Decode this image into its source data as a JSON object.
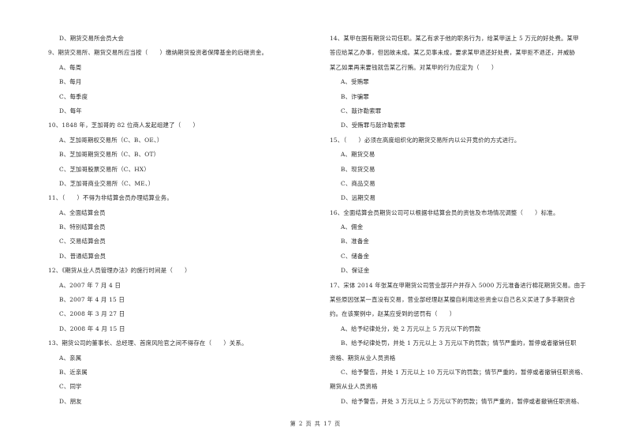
{
  "left_column": {
    "lines": [
      {
        "type": "option",
        "text": "D、期货交易所会员大会"
      },
      {
        "type": "question",
        "text": "9、期货交易所、期货交易所应当按（　　）缴纳期货投资者保障基金的后继资金。"
      },
      {
        "type": "option",
        "text": "A、每周"
      },
      {
        "type": "option",
        "text": "B、每月"
      },
      {
        "type": "option",
        "text": "C、每季度"
      },
      {
        "type": "option",
        "text": "D、每年"
      },
      {
        "type": "question",
        "text": "10、1848 年，芝加哥的 82 位商人发起组建了（　　）"
      },
      {
        "type": "option",
        "text": "A、芝加哥期权交易所（C、B、OE、）"
      },
      {
        "type": "option",
        "text": "B、芝加哥期货交易所（C、B、OT）"
      },
      {
        "type": "option",
        "text": "C、芝加哥股票交易所（C、HX）"
      },
      {
        "type": "option",
        "text": "D、芝加哥商业交易所（C、ME、）"
      },
      {
        "type": "question",
        "text": "11、（　　）不得为非结算会员办理结算业务。"
      },
      {
        "type": "option",
        "text": "A、全面结算会员"
      },
      {
        "type": "option",
        "text": "B、特别结算会员"
      },
      {
        "type": "option",
        "text": "C、交易结算会员"
      },
      {
        "type": "option",
        "text": "D、普通结算会员"
      },
      {
        "type": "question",
        "text": "12、《期货从业人员管理办法》的施行时间是（　　）"
      },
      {
        "type": "option",
        "text": "A、2007 年 7 月 4 日"
      },
      {
        "type": "option",
        "text": "B、2007 年 4 月 15 日"
      },
      {
        "type": "option",
        "text": "C、2008 年 3 月 27 日"
      },
      {
        "type": "option",
        "text": "D、2008 年 4 月 15 日"
      },
      {
        "type": "question",
        "text": "13、期货公司的董事长、总经理、首席风险官之间不得存在（　　）关系。"
      },
      {
        "type": "option",
        "text": "A、亲属"
      },
      {
        "type": "option",
        "text": "B、近亲属"
      },
      {
        "type": "option",
        "text": "C、同学"
      },
      {
        "type": "option",
        "text": "D、朋友"
      }
    ]
  },
  "right_column": {
    "lines": [
      {
        "type": "question",
        "text": "14、某甲在国有期货公司任职。某乙有求于他的职务行为，给某甲送上 5 万元的好处费。某甲"
      },
      {
        "type": "question",
        "text": "答应给某乙办事，但因故未成。某乙见事未成，要求某甲退还好处费，某甲拒不退还，并威胁"
      },
      {
        "type": "question",
        "text": "某乙如果再来要钱就告某乙行贿。对某甲的行为应定为（　　）"
      },
      {
        "type": "option",
        "text": "A、受贿罪"
      },
      {
        "type": "option",
        "text": "B、诈骗罪"
      },
      {
        "type": "option",
        "text": "C、敲诈勒索罪"
      },
      {
        "type": "option",
        "text": "D、受贿罪与敲诈勒索罪"
      },
      {
        "type": "question",
        "text": "15、（　　）必须在高度组织化的期货交易所内以公开竞价的方式进行。"
      },
      {
        "type": "option",
        "text": "A、期货交易"
      },
      {
        "type": "option",
        "text": "B、现货交易"
      },
      {
        "type": "option",
        "text": "C、商品交易"
      },
      {
        "type": "option",
        "text": "D、远期交易"
      },
      {
        "type": "question",
        "text": "16、全面结算会员期货公司可以根据非结算会员的资信及市场情况调整（　　）标准。"
      },
      {
        "type": "option",
        "text": "A、佣金"
      },
      {
        "type": "option",
        "text": "B、准备金"
      },
      {
        "type": "option",
        "text": "C、储备金"
      },
      {
        "type": "option",
        "text": "D、保证金"
      },
      {
        "type": "question",
        "text": "17、宋体 2014 年张某在甲期货公司营业部开户并存入 5000 万元准备进行棉花期货交易。由于"
      },
      {
        "type": "question",
        "text": "某些原因张某一直没有交易，营业部经理赵某擅自利用这些资金以自己名义买进了多手期货合"
      },
      {
        "type": "question",
        "text": "约。在该案例中，赵某应受到的惩罚有（　　）"
      },
      {
        "type": "option",
        "text": "A、给予纪律处分，处 2 万元以上 5 万元以下的罚款"
      },
      {
        "type": "option",
        "text": "B、给予纪律处罚，并处 1 万元以上 3 万元以下的罚款；情节严重的，暂停或者撤销任职"
      },
      {
        "type": "question",
        "text": "资格、期货从业人员资格"
      },
      {
        "type": "option",
        "text": "C、给予警告，并处 1 万元以上 10 万元以下的罚款；情节严重的，暂停或者撤销任职资格、"
      },
      {
        "type": "question",
        "text": "期货从业人员资格"
      },
      {
        "type": "option",
        "text": "D、给予警告，并处 3 万元以上 5 万元以下的罚款；情节严重的，暂停或者撤销任职资格、"
      }
    ]
  },
  "footer": {
    "page_label": "第 2 页 共 17 页"
  }
}
